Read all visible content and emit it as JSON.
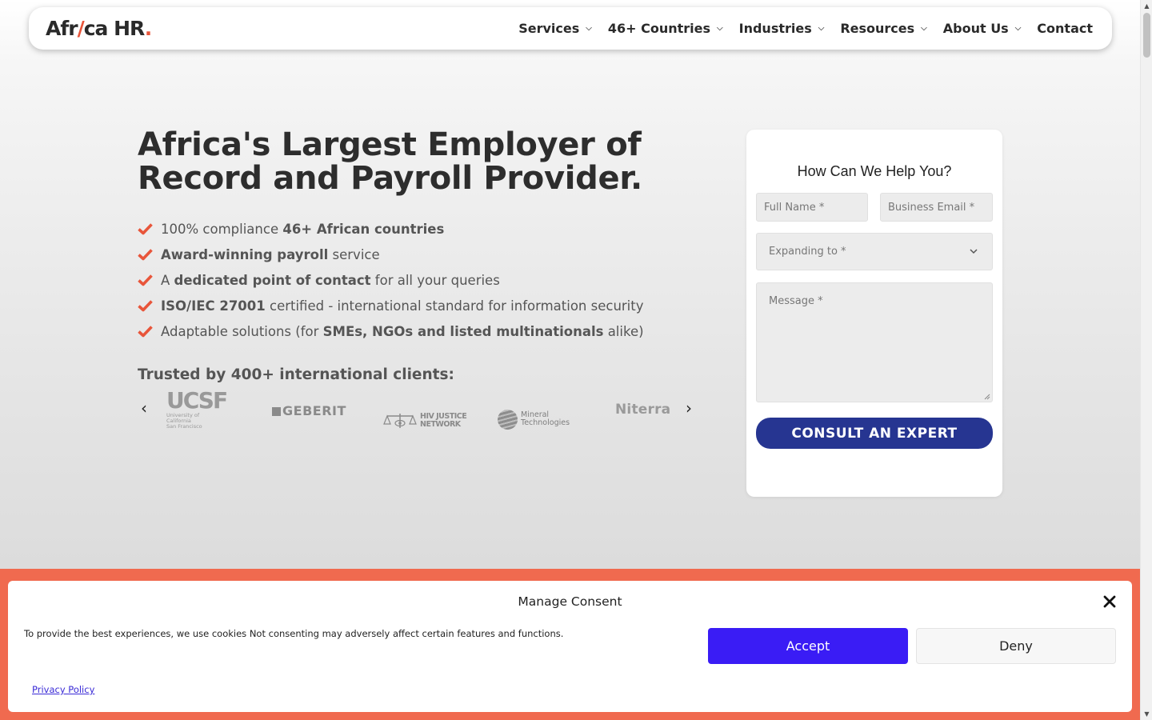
{
  "header": {
    "logo": {
      "part1": "Afr",
      "slash": "/",
      "part2": "ca HR",
      "dot": "."
    },
    "nav": [
      {
        "label": "Services",
        "dropdown": true
      },
      {
        "label": "46+ Countries",
        "dropdown": true
      },
      {
        "label": "Industries",
        "dropdown": true
      },
      {
        "label": "Resources",
        "dropdown": true
      },
      {
        "label": "About Us",
        "dropdown": true
      },
      {
        "label": "Contact",
        "dropdown": false
      }
    ]
  },
  "hero": {
    "title": "Africa's Largest Employer of Record and Payroll Provider.",
    "bullets": [
      {
        "pre": "100% compliance ",
        "bold": "46+ African countries",
        "post": ""
      },
      {
        "pre": "",
        "bold": "Award-winning payroll",
        "post": " service"
      },
      {
        "pre": "A ",
        "bold": "dedicated point of contact",
        "post": " for all your queries"
      },
      {
        "pre": "",
        "bold": "ISO/IEC 27001",
        "post": " certified - international standard for information security"
      },
      {
        "pre": "Adaptable solutions (for ",
        "bold": "SMEs, NGOs and listed multinationals",
        "post": " alike)"
      }
    ],
    "trusted": "Trusted by 400+ international clients:",
    "clients": {
      "ucsf": {
        "big": "UCSF",
        "small1": "University of California",
        "small2": "San Francisco"
      },
      "geberit": "GEBERIT",
      "hiv": {
        "line1": "HIV JUSTICE",
        "line2": "NETWORK"
      },
      "mineral": {
        "line1": "Mineral",
        "line2": "Technologies"
      },
      "niterra": "Niterra"
    },
    "carousel_prev": "‹",
    "carousel_next": "›"
  },
  "form": {
    "title": "How Can We Help You?",
    "full_name_placeholder": "Full Name *",
    "email_placeholder": "Business Email *",
    "expanding_placeholder": "Expanding to *",
    "message_placeholder": "Message *",
    "submit": "CONSULT AN EXPERT"
  },
  "consent": {
    "title": "Manage Consent",
    "text": "To provide the best experiences, we use cookies Not consenting may adversely affect certain features and functions.",
    "accept": "Accept",
    "deny": "Deny",
    "privacy": "Privacy Policy"
  },
  "colors": {
    "accent_orange": "#f06a4f",
    "check": "#e8553a",
    "button_navy": "#263591",
    "accept_blue": "#3a1cf5"
  }
}
